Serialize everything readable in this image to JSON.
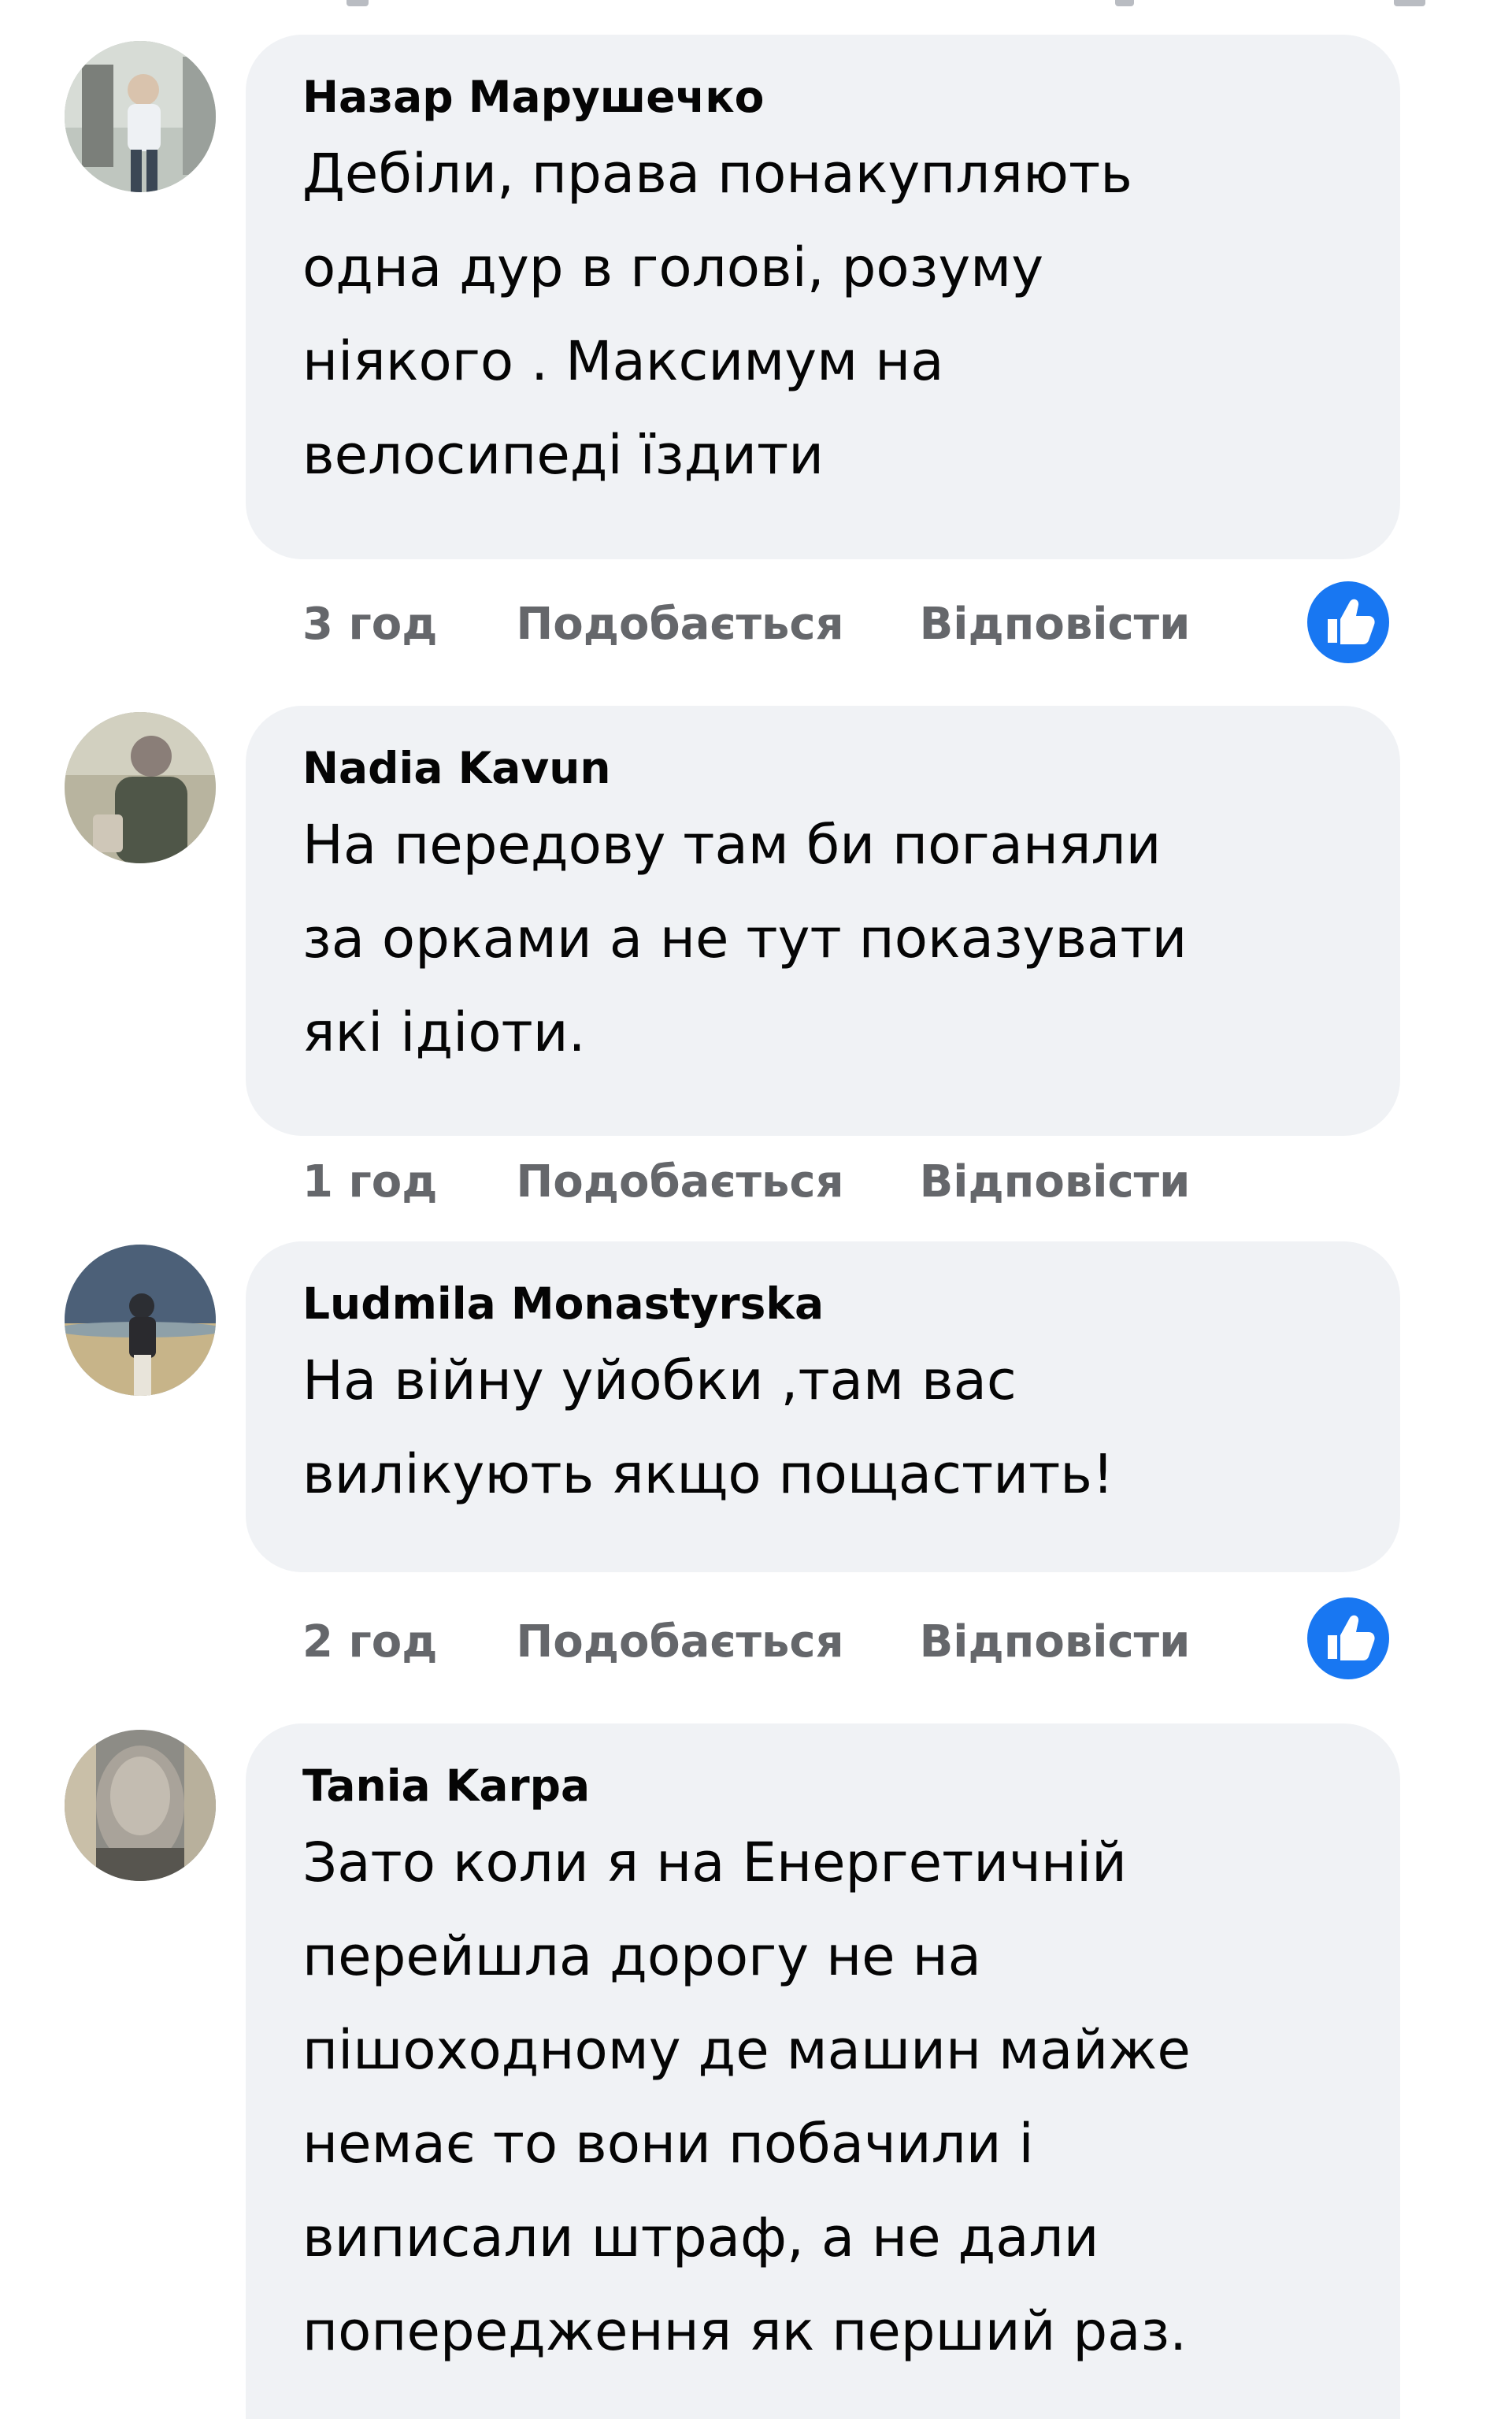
{
  "accent_color": "#1877f2",
  "comments": [
    {
      "author": "Назар Марушечко",
      "text": "Дебіли, права понакупляють\nодна дур в голові, розуму\nніякого . Максимум на\nвелосипеді їздити",
      "time": "3 год",
      "like_label": "Подобається",
      "reply_label": "Відповісти",
      "reaction_icon": "like-reaction-icon"
    },
    {
      "author": "Nadia Kavun",
      "text": "На передову там би поганяли\nза орками а не тут показувати\nякі ідіоти.",
      "time": "1 год",
      "like_label": "Подобається",
      "reply_label": "Відповісти"
    },
    {
      "author": "Ludmila Monastyrska",
      "text": "На війну уйобки ,там вас\nвилікують якщо пощастить!",
      "time": "2 год",
      "like_label": "Подобається",
      "reply_label": "Відповісти",
      "reaction_icon": "like-reaction-icon"
    },
    {
      "author": "Tania Karpa",
      "text": "Зато коли я на Енергетичній\nперейшла дорогу не на\nпішоходному де машин майже\nнемає то вони побачили і\nвиписали штраф, а не дали\nпопередження як перший раз."
    }
  ]
}
